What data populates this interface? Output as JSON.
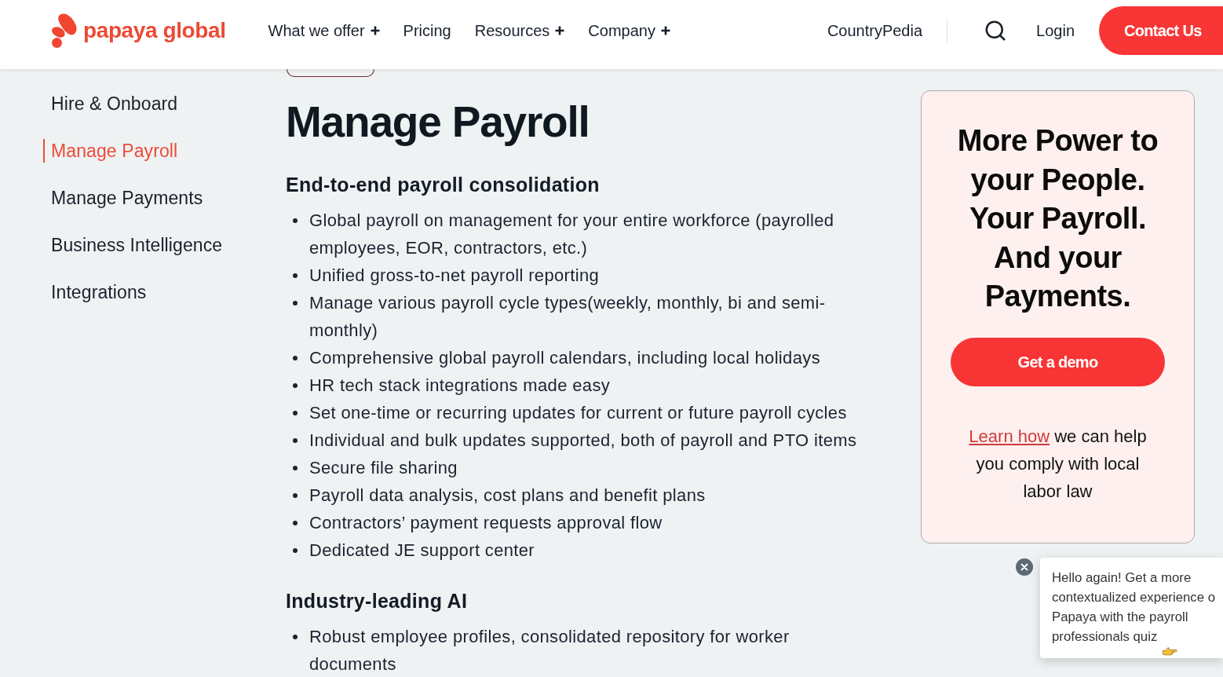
{
  "header": {
    "logo": "papaya global",
    "nav": [
      {
        "label": "What we offer",
        "has_menu": true
      },
      {
        "label": "Pricing",
        "has_menu": false
      },
      {
        "label": "Resources",
        "has_menu": true
      },
      {
        "label": "Company",
        "has_menu": true
      }
    ],
    "countrypedia": "CountryPedia",
    "login": "Login",
    "contact_button": "Contact Us"
  },
  "sidebar": {
    "items": [
      {
        "label": "Hire & Onboard",
        "selected": false
      },
      {
        "label": "Manage Payroll",
        "selected": true
      },
      {
        "label": "Manage Payments",
        "selected": false
      },
      {
        "label": "Business Intelligence",
        "selected": false
      },
      {
        "label": "Integrations",
        "selected": false
      }
    ]
  },
  "content": {
    "title": "Manage Payroll",
    "sections": [
      {
        "heading": "End-to-end payroll consolidation",
        "bullets": [
          "Global payroll on management for your entire workforce (payrolled employees, EOR, contractors, etc.)",
          "Unified gross-to-net payroll reporting",
          "Manage various payroll cycle types(weekly, monthly, bi and semi-monthly)",
          "Comprehensive global payroll calendars, including local holidays",
          "HR tech stack integrations made easy",
          "Set one-time or recurring updates for current or future payroll cycles",
          "Individual and bulk updates supported, both of payroll and PTO items",
          "Secure file sharing",
          "Payroll data analysis, cost plans and benefit plans",
          "Contractors’ payment requests approval flow",
          "Dedicated JE support center"
        ]
      },
      {
        "heading": "Industry-leading AI",
        "bullets": [
          "Robust employee profiles, consolidated repository for worker documents"
        ]
      }
    ]
  },
  "promo_card": {
    "title": "More Power to your People. Your Payroll. And your Payments.",
    "button": "Get a demo",
    "link": "Learn how",
    "text": "we can help you comply with local labor law"
  },
  "chat_popup": {
    "message": "Hello again! Get a more contextualized experience o Papaya with the payroll professionals quiz"
  }
}
